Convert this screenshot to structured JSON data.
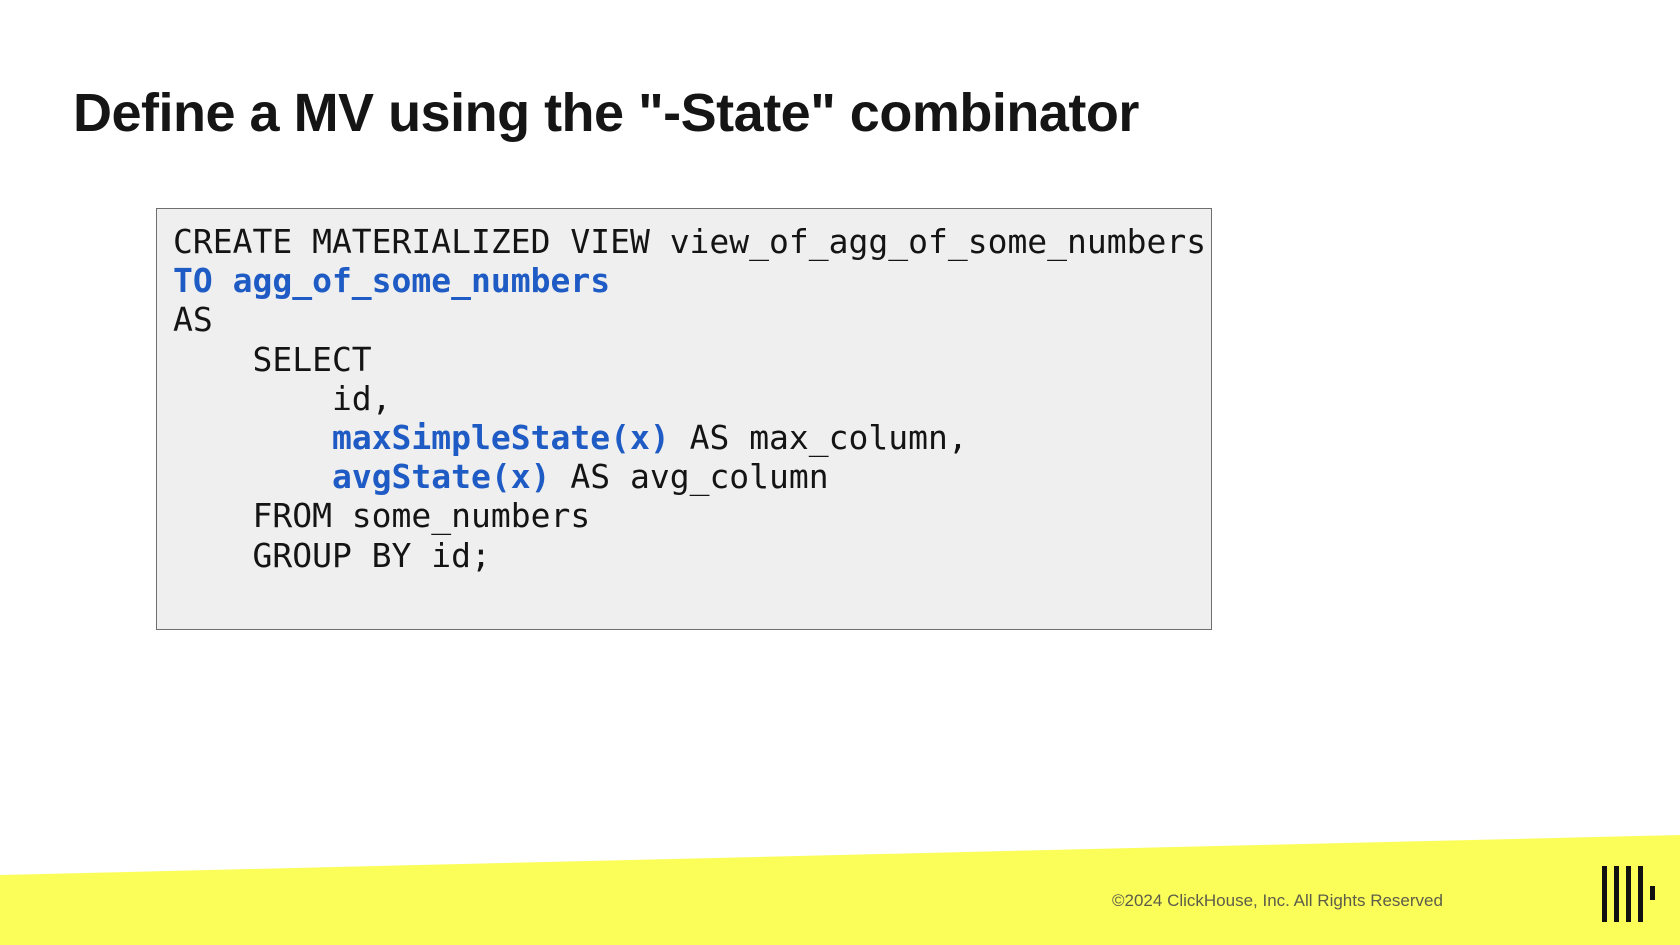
{
  "slide": {
    "title": "Define a MV using the \"-State\" combinator"
  },
  "code": {
    "lines": [
      [
        {
          "text": "CREATE MATERIALIZED VIEW view_of_agg_of_some_numbers",
          "highlight": false
        }
      ],
      [
        {
          "text": "TO agg_of_some_numbers",
          "highlight": true
        }
      ],
      [
        {
          "text": "AS",
          "highlight": false
        }
      ],
      [
        {
          "text": "    SELECT",
          "highlight": false
        }
      ],
      [
        {
          "text": "        id,",
          "highlight": false
        }
      ],
      [
        {
          "text": "        ",
          "highlight": false
        },
        {
          "text": "maxSimpleState(x)",
          "highlight": true
        },
        {
          "text": " AS max_column,",
          "highlight": false
        }
      ],
      [
        {
          "text": "        ",
          "highlight": false
        },
        {
          "text": "avgState(x)",
          "highlight": true
        },
        {
          "text": " AS avg_column",
          "highlight": false
        }
      ],
      [
        {
          "text": "    FROM some_numbers",
          "highlight": false
        }
      ],
      [
        {
          "text": "    GROUP BY id;",
          "highlight": false
        }
      ]
    ]
  },
  "footer": {
    "copyright": "©2024 ClickHouse, Inc. All Rights Reserved",
    "logo_icon": "clickhouse-logo-icon",
    "band_color": "#fbfe58"
  },
  "colors": {
    "highlight": "#1f5bc4",
    "code_background": "#efefef",
    "title": "#151515"
  }
}
